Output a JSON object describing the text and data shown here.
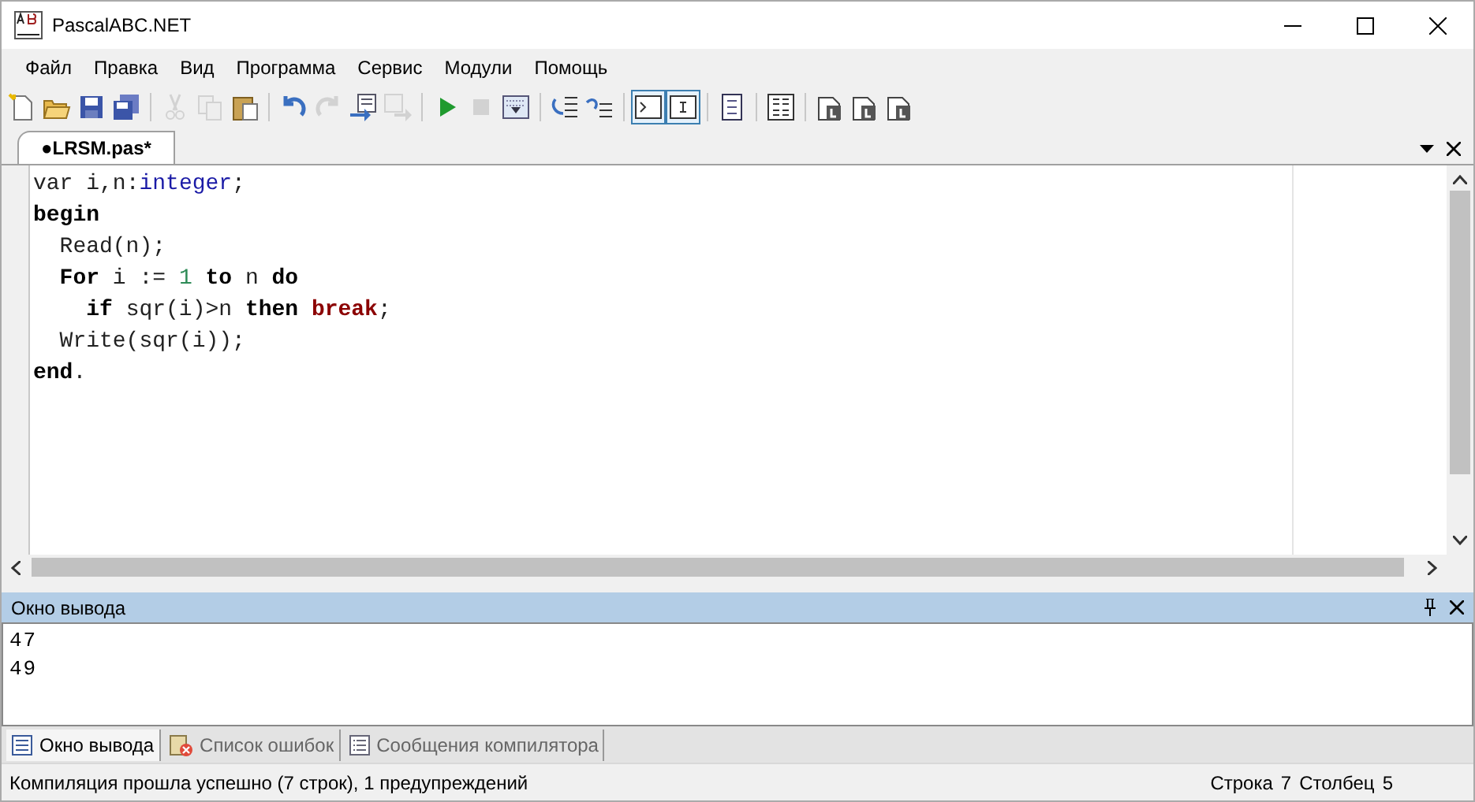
{
  "window": {
    "title": "PascalABC.NET"
  },
  "menu": [
    "Файл",
    "Правка",
    "Вид",
    "Программа",
    "Сервис",
    "Модули",
    "Помощь"
  ],
  "toolbar": [
    [
      {
        "disabled": false,
        "pressed": false
      },
      {
        "disabled": false,
        "pressed": false
      },
      {
        "disabled": false,
        "pressed": false
      },
      {
        "disabled": false,
        "pressed": false
      }
    ],
    [
      {
        "disabled": true,
        "pressed": false
      },
      {
        "disabled": true,
        "pressed": false
      },
      {
        "disabled": false,
        "pressed": false
      }
    ],
    [
      {
        "disabled": false,
        "pressed": false
      },
      {
        "disabled": true,
        "pressed": false
      },
      {
        "disabled": false,
        "pressed": false
      },
      {
        "disabled": true,
        "pressed": false
      }
    ],
    [
      {
        "disabled": false,
        "pressed": false
      },
      {
        "disabled": true,
        "pressed": false
      },
      {
        "disabled": false,
        "pressed": false
      }
    ],
    [
      {
        "disabled": false,
        "pressed": false
      },
      {
        "disabled": false,
        "pressed": false
      }
    ],
    [
      {
        "disabled": false,
        "pressed": true
      },
      {
        "disabled": false,
        "pressed": true
      }
    ],
    [
      {
        "disabled": false,
        "pressed": false
      }
    ],
    [
      {
        "disabled": false,
        "pressed": false
      }
    ],
    [
      {
        "disabled": false,
        "pressed": false
      },
      {
        "disabled": false,
        "pressed": false
      },
      {
        "disabled": false,
        "pressed": false
      }
    ]
  ],
  "editor_tabs": [
    {
      "label": "●LRSM.pas*",
      "selected": true
    }
  ],
  "code": [
    [
      {
        "text": "var",
        "kind": "plain"
      },
      {
        "text": " i,n:",
        "kind": "plain"
      },
      {
        "text": "integer",
        "kind": "type"
      },
      {
        "text": ";",
        "kind": "plain"
      }
    ],
    [
      {
        "text": "begin",
        "kind": "keyword"
      }
    ],
    [
      {
        "text": "  Read(n);",
        "kind": "plain"
      }
    ],
    [
      {
        "text": "  For",
        "kind": "keyword"
      },
      {
        "text": " i := ",
        "kind": "plain"
      },
      {
        "text": "1",
        "kind": "number"
      },
      {
        "text": " to",
        "kind": "keyword"
      },
      {
        "text": " n ",
        "kind": "plain"
      },
      {
        "text": "do",
        "kind": "keyword"
      }
    ],
    [
      {
        "text": "    if",
        "kind": "keyword"
      },
      {
        "text": " sqr(i)>n ",
        "kind": "plain"
      },
      {
        "text": "then",
        "kind": "keyword"
      },
      {
        "text": " break",
        "kind": "special"
      },
      {
        "text": ";",
        "kind": "plain"
      }
    ],
    [
      {
        "text": "  Write(sqr(i));",
        "kind": "plain"
      }
    ],
    [
      {
        "text": "end",
        "kind": "keyword"
      },
      {
        "text": ".",
        "kind": "plain"
      }
    ]
  ],
  "output_panel": {
    "title": "Окно вывода",
    "lines": [
      "47",
      "49"
    ]
  },
  "bottom_tabs": [
    {
      "label": "Окно вывода",
      "selected": true,
      "kind": "output"
    },
    {
      "label": "Список ошибок",
      "selected": false,
      "kind": "errors"
    },
    {
      "label": "Сообщения компилятора",
      "selected": false,
      "kind": "messages"
    }
  ],
  "status_bar": {
    "message": "Компиляция прошла успешно (7 строк), 1 предупреждений",
    "line_label": "Строка",
    "line": "7",
    "column_label": "Столбец",
    "column": "5"
  }
}
